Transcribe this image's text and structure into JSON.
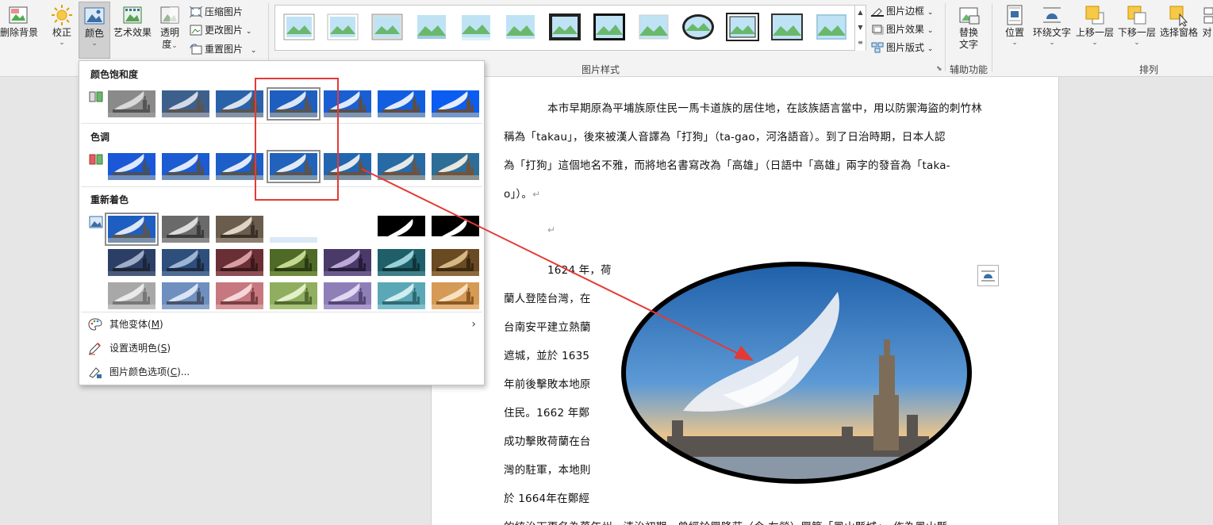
{
  "ribbon": {
    "buttons": {
      "remove_bg": "删除背景",
      "corrections": "校正",
      "color": "颜色",
      "artistic": "艺术效果",
      "transparency_l1": "透明",
      "transparency_l2": "度",
      "compress": "压缩图片",
      "change": "更改图片",
      "reset": "重置图片",
      "border": "图片边框",
      "effects": "图片效果",
      "layout": "图片版式",
      "alt_text_l1": "替换",
      "alt_text_l2": "文字",
      "position": "位置",
      "wrap": "环绕文字",
      "forward": "上移一层",
      "backward": "下移一层",
      "selection": "选择窗格",
      "align": "对"
    },
    "groups": {
      "picture_styles": "图片样式",
      "accessibility": "辅助功能",
      "arrange": "排列"
    },
    "chevron": "⌄"
  },
  "dropdown": {
    "saturation_title": "颜色饱和度",
    "tone_title": "色调",
    "recolor_title": "重新着色",
    "more_variations": "其他变体(",
    "more_variations_key": "M",
    "set_transparent": "设置透明色(",
    "set_transparent_key": "S",
    "color_options": "图片颜色选项(",
    "color_options_key": "C",
    "color_options_suffix": "...",
    "close_paren": ")"
  },
  "document": {
    "p1_l1": "本市早期原為平埔族原住民一馬卡道族的居住地，在該族語言當中，用以防禦海盜的刺竹林",
    "p1_l2": "稱為「takau」，後來被漢人音譯為「打狗」（ta-gao，河洛語音）。到了日治時期，日本人認",
    "p1_l3": "為「打狗」這個地名不雅，而將地名書寫改為「高雄」（日語中「高雄」兩字的發音為「taka-",
    "p1_l4": "o」）。",
    "p2_lines": [
      "1624 年，荷",
      "蘭人登陸台灣，在",
      "台南安平建立熱蘭",
      "遮城，並於 1635",
      "年前後擊敗本地原",
      "住民。1662 年鄭",
      "成功擊敗荷蘭在台",
      "灣的駐軍，本地則",
      "於 1664年在鄭經"
    ],
    "p2_last": "的統治下更名為萬年州。清治初期，曾經於興隆莊（今 左營）興築「鳳山縣城」，作為鳳山縣",
    "return_mark": "↵"
  }
}
